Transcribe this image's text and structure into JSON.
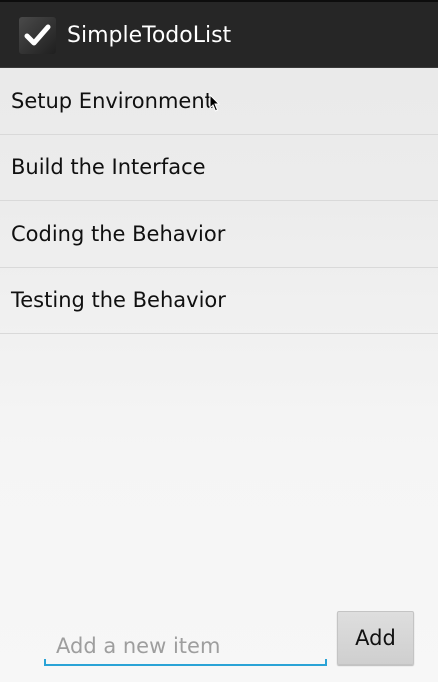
{
  "app": {
    "title": "SimpleTodoList",
    "icon": "checkmark-icon"
  },
  "todo_items": [
    "Setup Environment",
    "Build the Interface",
    "Coding the Behavior",
    "Testing the Behavior"
  ],
  "new_item": {
    "value": "",
    "placeholder": "Add a new item"
  },
  "add_button": {
    "label": "Add"
  },
  "colors": {
    "action_bar": "#262626",
    "input_accent": "#2aa3d6",
    "list_divider": "#d9d9d9"
  }
}
